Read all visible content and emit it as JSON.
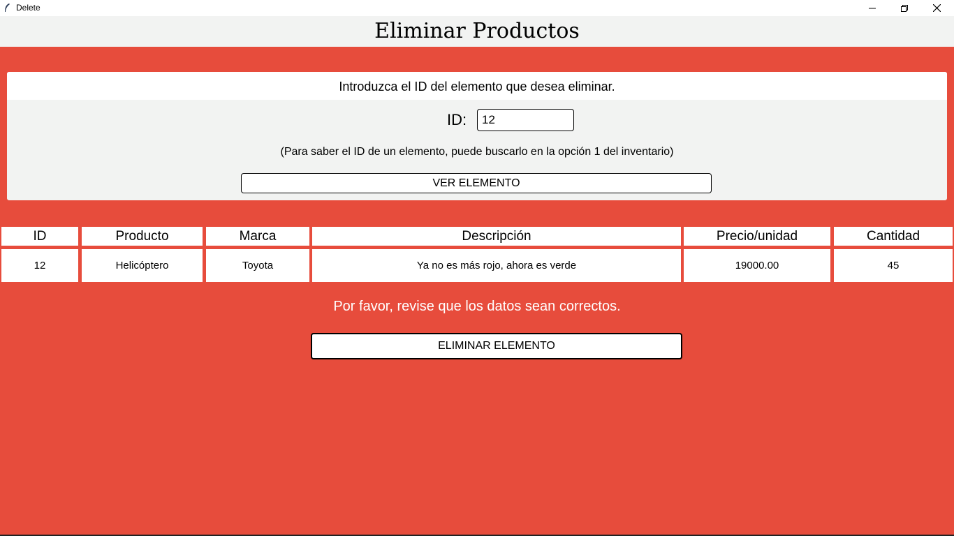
{
  "window": {
    "title": "Delete",
    "icon": "feather-icon"
  },
  "header": {
    "title": "Eliminar Productos"
  },
  "panel": {
    "instruction": "Introduzca el ID del elemento que desea eliminar.",
    "id_label": "ID:",
    "id_value": "12",
    "hint": "(Para saber el ID de un elemento, puede buscarlo en la opción 1 del inventario)",
    "view_button": "VER ELEMENTO"
  },
  "table": {
    "headers": [
      "ID",
      "Producto",
      "Marca",
      "Descripción",
      "Precio/unidad",
      "Cantidad"
    ],
    "row": [
      "12",
      "Helicóptero",
      "Toyota",
      "Ya no es más rojo, ahora es verde",
      "19000.00",
      "45"
    ]
  },
  "confirm_message": "Por favor, revise que los datos sean correctos.",
  "delete_button": "ELIMINAR ELEMENTO",
  "colors": {
    "background": "#e74c3c",
    "panel": "#f2f3f2",
    "cell": "#ffffff"
  }
}
